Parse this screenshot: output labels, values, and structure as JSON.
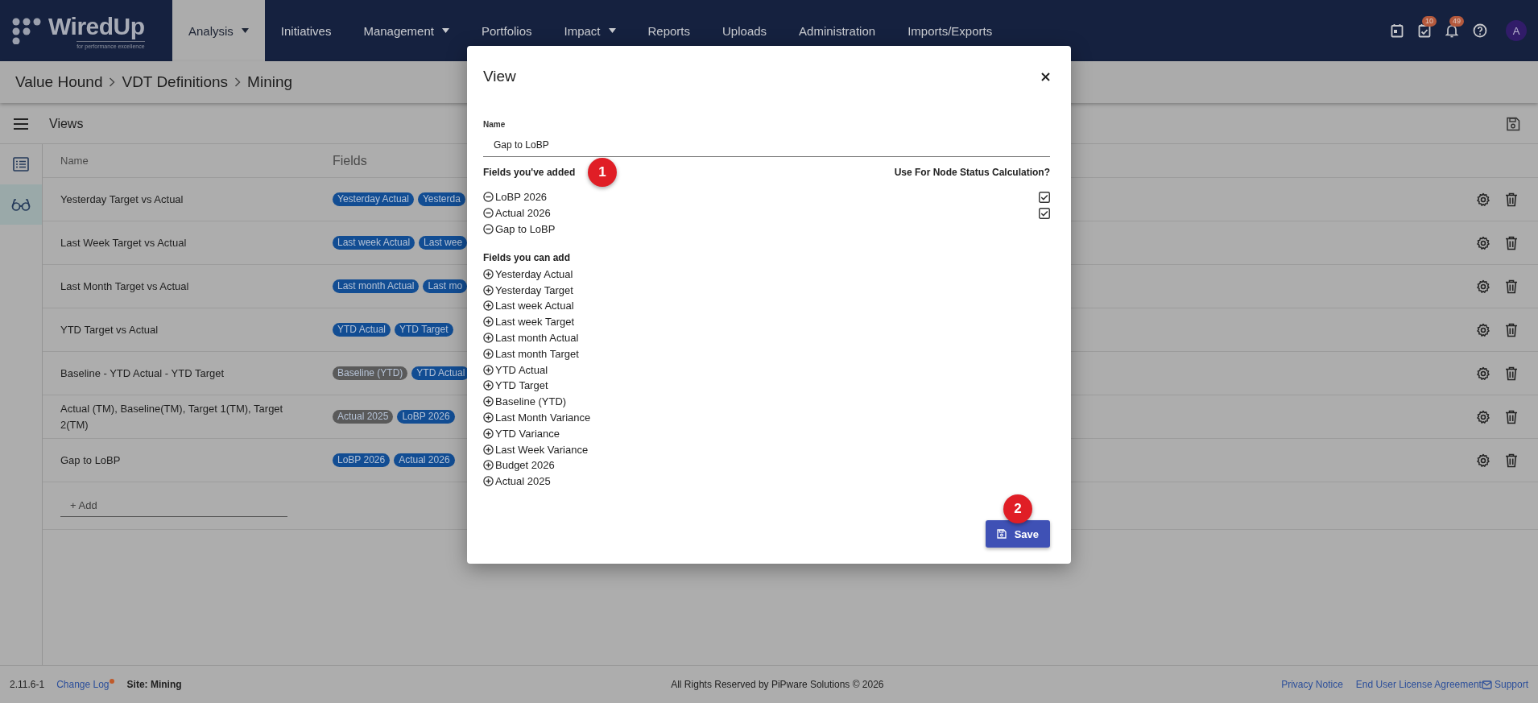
{
  "nav": {
    "logo": {
      "name": "WiredUp",
      "tagline": "for performance excellence"
    },
    "items": [
      {
        "label": "Analysis",
        "selected": true,
        "has_menu": true
      },
      {
        "label": "Initiatives",
        "selected": false,
        "has_menu": false
      },
      {
        "label": "Management",
        "selected": false,
        "has_menu": true
      },
      {
        "label": "Portfolios",
        "selected": false,
        "has_menu": false
      },
      {
        "label": "Impact",
        "selected": false,
        "has_menu": true
      },
      {
        "label": "Reports",
        "selected": false,
        "has_menu": false
      },
      {
        "label": "Uploads",
        "selected": false,
        "has_menu": false
      },
      {
        "label": "Administration",
        "selected": false,
        "has_menu": false
      },
      {
        "label": "Imports/Exports",
        "selected": false,
        "has_menu": false
      }
    ],
    "icons": [
      {
        "kind": "calendar"
      },
      {
        "kind": "tasks",
        "badge": "10"
      },
      {
        "kind": "bell",
        "badge": "49"
      },
      {
        "kind": "help"
      }
    ],
    "avatar": "A"
  },
  "breadcrumbs": [
    "Value Hound",
    "VDT Definitions",
    "Mining"
  ],
  "toolbar": {
    "title": "Views"
  },
  "sidebar": {
    "items": [
      {
        "kind": "list",
        "selected": false
      },
      {
        "kind": "glasses",
        "selected": true
      }
    ]
  },
  "table": {
    "columns": [
      "Name",
      "Fields"
    ],
    "rows": [
      {
        "name": "Yesterday Target vs Actual",
        "fields": [
          {
            "label": "Yesterday Actual",
            "color": "#124d93"
          },
          {
            "label": "Yesterda",
            "color": "#124d93"
          }
        ]
      },
      {
        "name": "Last Week Target vs Actual",
        "fields": [
          {
            "label": "Last week Actual",
            "color": "#124d93"
          },
          {
            "label": "Last wee",
            "color": "#124d93"
          }
        ]
      },
      {
        "name": "Last Month Target vs Actual",
        "fields": [
          {
            "label": "Last month Actual",
            "color": "#124d93"
          },
          {
            "label": "Last mo",
            "color": "#124d93"
          }
        ]
      },
      {
        "name": "YTD Target vs Actual",
        "fields": [
          {
            "label": "YTD Actual",
            "color": "#124d93"
          },
          {
            "label": "YTD Target",
            "color": "#124d93"
          }
        ]
      },
      {
        "name": "Baseline - YTD Actual - YTD Target",
        "fields": [
          {
            "label": "Baseline (YTD)",
            "color": "#5a5a5a"
          },
          {
            "label": "YTD Actual",
            "color": "#124d93"
          }
        ]
      },
      {
        "name": "Actual (TM), Baseline(TM), Target 1(TM), Target 2(TM)",
        "fields": [
          {
            "label": "Actual 2025",
            "color": "#5a5a5a"
          },
          {
            "label": "LoBP 2026",
            "color": "#124d93"
          }
        ]
      },
      {
        "name": "Gap to LoBP",
        "fields": [
          {
            "label": "LoBP 2026",
            "color": "#124d93"
          },
          {
            "label": "Actual 2026",
            "color": "#124d93"
          }
        ]
      }
    ],
    "add": "+ Add"
  },
  "dialog": {
    "title": "View",
    "name_label": "Name",
    "name_value": "Gap to LoBP",
    "added_heading": "Fields you've added",
    "added_marker": "1",
    "status_heading": "Use For Node Status Calculation?",
    "added": [
      {
        "label": "LoBP 2026",
        "checked": true
      },
      {
        "label": "Actual 2026",
        "checked": true
      },
      {
        "label": "Gap to LoBP"
      }
    ],
    "available_heading": "Fields you can add",
    "available": [
      "Yesterday Actual",
      "Yesterday Target",
      "Last week Actual",
      "Last week Target",
      "Last month Actual",
      "Last month Target",
      "YTD Actual",
      "YTD Target",
      "Baseline (YTD)",
      "Last Month Variance",
      "YTD Variance",
      "Last Week Variance",
      "Budget 2026",
      "Actual 2025"
    ],
    "save": "Save",
    "save_marker": "2"
  },
  "footer": {
    "version": "2.11.6-1",
    "change_log": "Change Log",
    "site": "Site: Mining",
    "copyright": "All Rights Reserved by PiPware Solutions © 2026",
    "links": [
      "Privacy Notice",
      "End User License Agreement"
    ],
    "support": "Support"
  }
}
